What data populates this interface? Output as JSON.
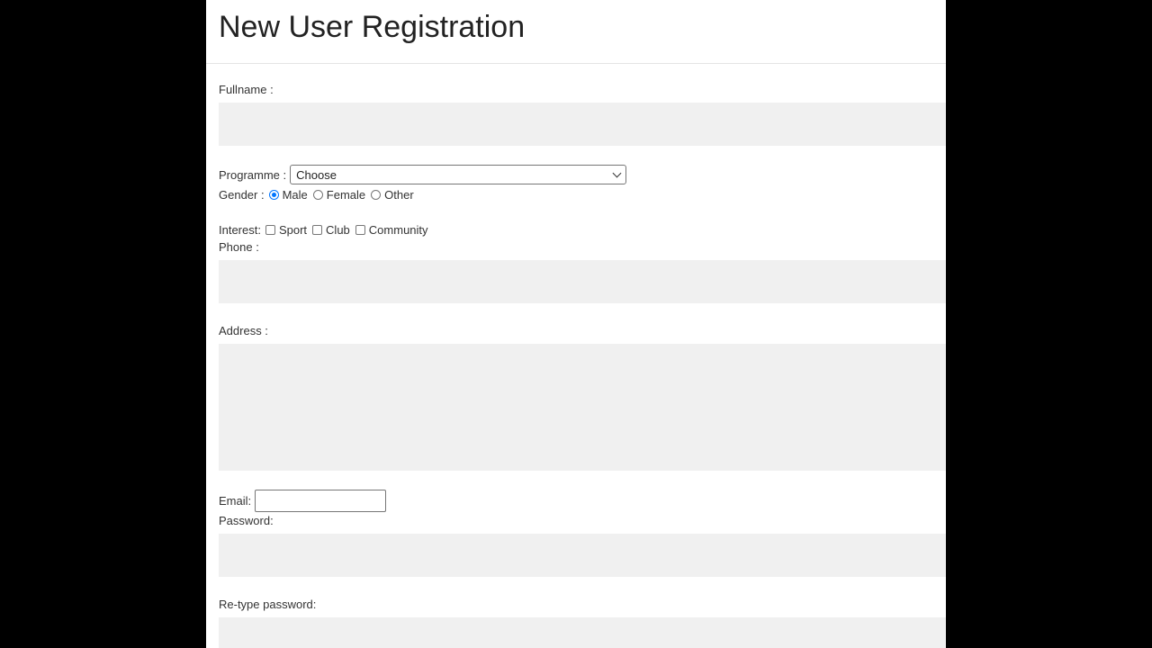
{
  "page": {
    "title": "New User Registration"
  },
  "form": {
    "fullname": {
      "label": "Fullname :",
      "value": ""
    },
    "programme": {
      "label": "Programme :",
      "selected": "Choose"
    },
    "gender": {
      "label": "Gender :",
      "options": [
        "Male",
        "Female",
        "Other"
      ],
      "selected": "Male"
    },
    "interest": {
      "label": "Interest:",
      "options": [
        "Sport",
        "Club",
        "Community"
      ]
    },
    "phone": {
      "label": "Phone :",
      "value": ""
    },
    "address": {
      "label": "Address :",
      "value": ""
    },
    "email": {
      "label": "Email:",
      "value": ""
    },
    "password": {
      "label": "Password:",
      "value": ""
    },
    "retype_password": {
      "label": "Re-type password:",
      "value": ""
    }
  },
  "colors": {
    "background": "#000000",
    "panel": "#ffffff",
    "field_fill": "#f0f0f0",
    "radio_accent": "#0075ff"
  }
}
